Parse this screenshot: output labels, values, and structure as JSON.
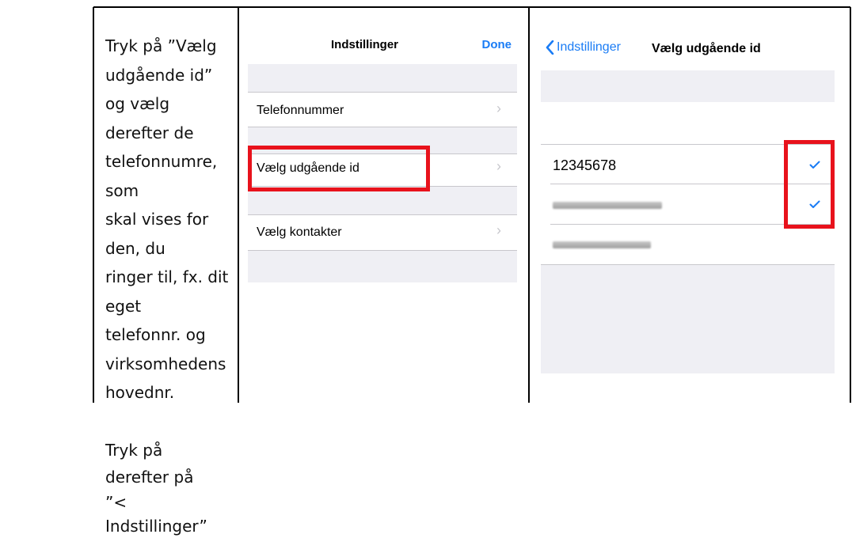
{
  "instructions": {
    "paragraph1": "Tryk på ”Vælg udgående id” og vælg derefter de telefonnumre, som skal vises for den, du ringer til, fx. dit eget telefonnr. og virksomhedens hovednr.",
    "paragraph1_lines": [
      "Tryk på ”Vælg",
      "udgående id” og vælg",
      "derefter de",
      "telefonnumre, som",
      "skal vises for den, du",
      "ringer til, fx. dit eget",
      "telefonnr. og",
      "virksomhedens",
      "hovednr."
    ],
    "paragraph2_lines": [
      "Tryk på derefter på",
      "”< Indstillinger”"
    ]
  },
  "screen1": {
    "title": "Indstillinger",
    "done_label": "Done",
    "rows": [
      {
        "label": "Telefonnummer"
      },
      {
        "label": "Vælg udgående id",
        "highlighted": true
      },
      {
        "label": "Vælg kontakter"
      }
    ]
  },
  "screen2": {
    "back_label": "Indstillinger",
    "title": "Vælg udgående id",
    "numbers": [
      {
        "label": "12345678",
        "checked": true
      },
      {
        "label": "",
        "redacted": true,
        "checked": true
      },
      {
        "label": "",
        "redacted": true,
        "checked": false
      }
    ]
  },
  "colors": {
    "accent": "#1a7cf5",
    "highlight": "#e8121c",
    "grouped_background": "#efeff4"
  }
}
